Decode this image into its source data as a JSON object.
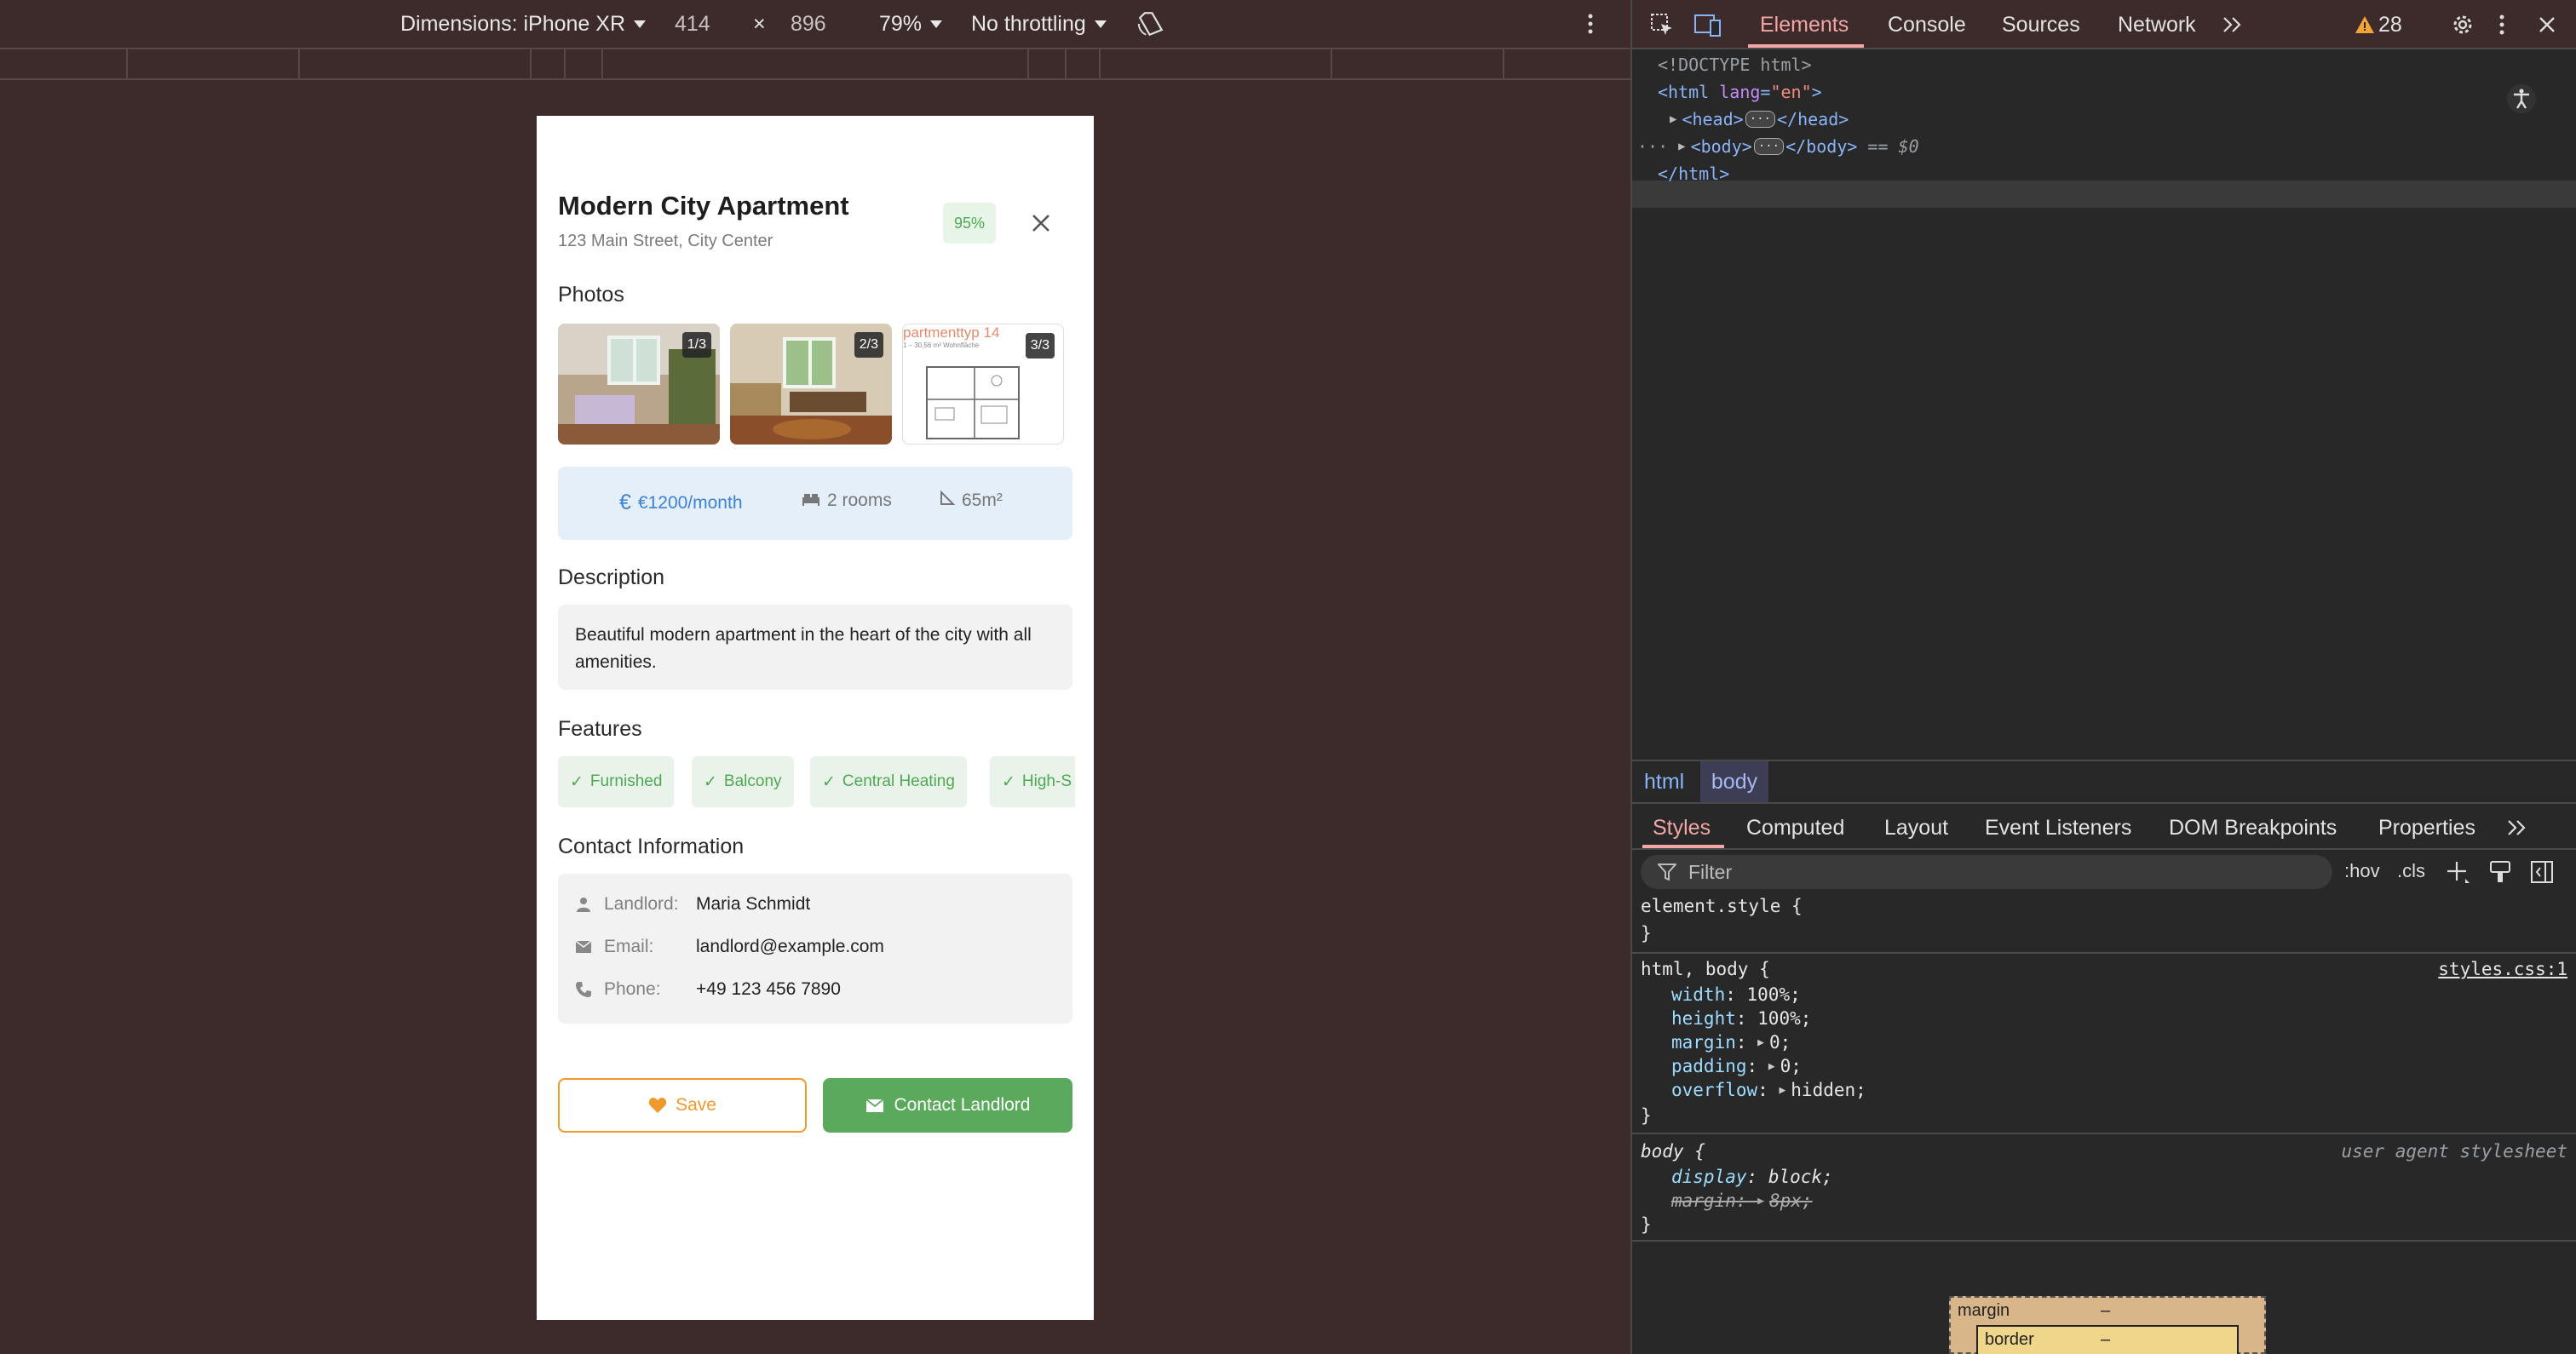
{
  "device_toolbar": {
    "dimensions_label": "Dimensions: iPhone XR",
    "width": "414",
    "times": "×",
    "height": "896",
    "zoom": "79%",
    "throttling": "No throttling"
  },
  "listing": {
    "title": "Modern City Apartment",
    "address": "123 Main Street, City Center",
    "match_percent": "95%",
    "photos_heading": "Photos",
    "photos": [
      {
        "counter": "1/3",
        "kind": "bedroom photo"
      },
      {
        "counter": "2/3",
        "kind": "living room photo"
      },
      {
        "counter": "3/3",
        "kind": "floor plan",
        "caption": "partmenttyp 14",
        "subcaption": "1 – 30,56 m² Wohnfläche"
      }
    ],
    "stats": {
      "price": "€1200/month",
      "rooms": "2 rooms",
      "area": "65m²"
    },
    "description_heading": "Description",
    "description": "Beautiful modern apartment in the heart of the city with all amenities.",
    "features_heading": "Features",
    "features": [
      "Furnished",
      "Balcony",
      "Central Heating",
      "High-S"
    ],
    "contact_heading": "Contact Information",
    "contact": {
      "landlord_label": "Landlord:",
      "landlord": "Maria Schmidt",
      "email_label": "Email:",
      "email": "landlord@example.com",
      "phone_label": "Phone:",
      "phone": "+49 123 456 7890"
    },
    "save_label": "Save",
    "contact_label": "Contact Landlord",
    "colors": {
      "save": "#f09a2b",
      "contact": "#5aa95c",
      "price": "#3b82d6",
      "match": "#4ea952"
    }
  },
  "devtools": {
    "tabs": [
      "Elements",
      "Console",
      "Sources",
      "Network"
    ],
    "warnings": "28",
    "dom": {
      "doctype": "<!DOCTYPE html>",
      "html_open_tag": "<html ",
      "html_attr": "lang",
      "html_attr_val": "\"en\"",
      "html_open_end": ">",
      "head_open": "<head>",
      "head_close": "</head>",
      "body_open": "<body>",
      "body_close": "</body>",
      "body_marker": "== $0",
      "html_close": "</html>",
      "ellipsis": "···"
    },
    "breadcrumbs": [
      "html",
      "body"
    ],
    "styles_tabs": [
      "Styles",
      "Computed",
      "Layout",
      "Event Listeners",
      "DOM Breakpoints",
      "Properties"
    ],
    "filter_placeholder": "Filter",
    "hov": ":hov",
    "cls": ".cls",
    "rules": {
      "element_style": "element.style {",
      "close_brace": "}",
      "html_body_selector": "html, body {",
      "html_body_source": "styles.css:1",
      "html_body_props": [
        {
          "name": "width",
          "value": "100%;"
        },
        {
          "name": "height",
          "value": "100%;"
        },
        {
          "name": "margin",
          "value": "0;"
        },
        {
          "name": "padding",
          "value": "0;"
        },
        {
          "name": "overflow",
          "value": "hidden;"
        }
      ],
      "body_selector": "body {",
      "body_source": "user agent stylesheet",
      "body_display_name": "display",
      "body_display_val": "block;",
      "body_margin_name": "margin",
      "body_margin_val": "8px;"
    },
    "box_model": {
      "margin": "margin",
      "border": "border",
      "dash": "–"
    }
  }
}
